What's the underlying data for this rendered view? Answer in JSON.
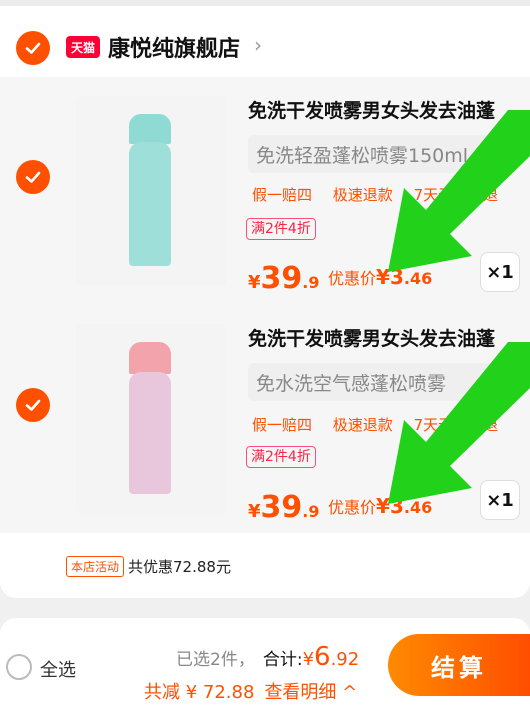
{
  "colors": {
    "accent": "#ff5000",
    "tmall": "#ff0036",
    "arrow": "#22d11a"
  },
  "store": {
    "badge": "天猫",
    "name": "康悦纯旗舰店",
    "chevron": "›"
  },
  "items": [
    {
      "title": "免洗干发喷雾男女头发去油蓬",
      "variant": "免洗轻盈蓬松喷雾150ml",
      "perks": [
        "假一赔四",
        "极速退款",
        "7天无理由退"
      ],
      "promo": "满2件4折",
      "price_cur": "¥",
      "price_int": "39",
      "price_dec": ".9",
      "discount_label": "优惠价",
      "discount_cur": "¥",
      "discount_int": "3",
      "discount_dec": ".46",
      "qty": "×1",
      "bottle_color": "#93ddd6",
      "cap_color": "#93ddd6"
    },
    {
      "title": "免洗干发喷雾男女头发去油蓬",
      "variant": "免水洗空气感蓬松喷雾",
      "perks": [
        "假一赔四",
        "极速退款",
        "7天无理由退"
      ],
      "promo": "满2件4折",
      "price_cur": "¥",
      "price_int": "39",
      "price_dec": ".9",
      "discount_label": "优惠价",
      "discount_cur": "¥",
      "discount_int": "3",
      "discount_dec": ".46",
      "qty": "×1",
      "bottle_color": "#e8c6dc",
      "cap_color": "#f2a3ab"
    }
  ],
  "activity": {
    "tag": "本店活动",
    "text": "共优惠72.88元"
  },
  "footer": {
    "select_all": "全选",
    "selected": "已选2件，",
    "total_label": "合计:",
    "total_cur": "¥",
    "total_value": "6",
    "total_dec": ".92",
    "saved": "共减 ¥ 72.88",
    "detail": "查看明细 ^",
    "checkout": "结算"
  }
}
